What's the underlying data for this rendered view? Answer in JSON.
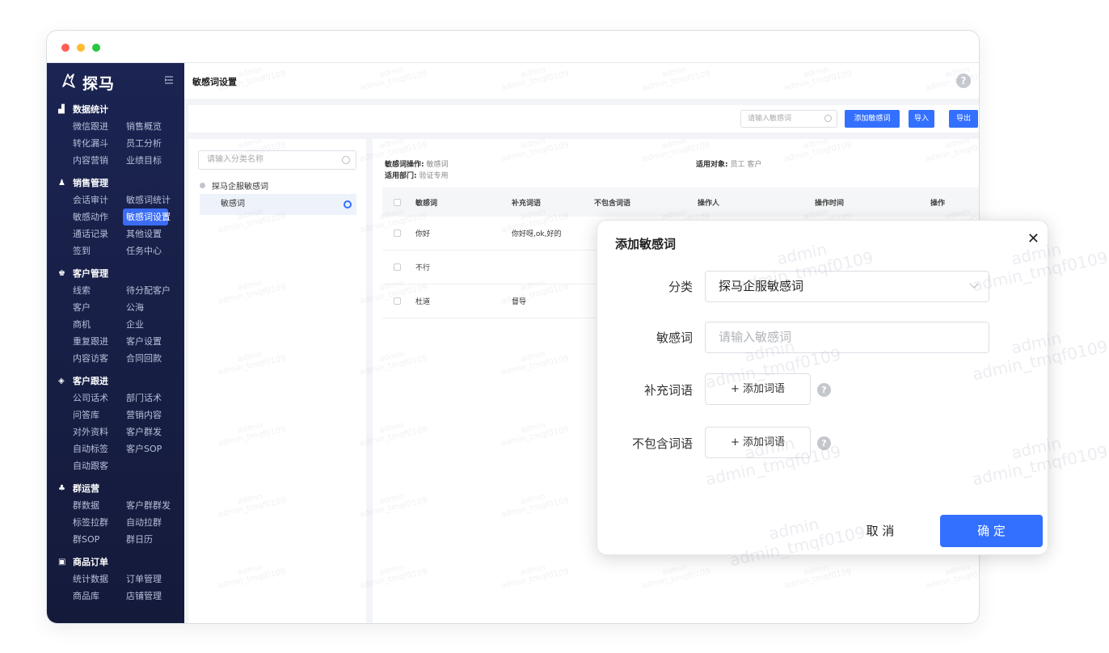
{
  "app": {
    "brand": "探马",
    "page_title": "敏感词设置"
  },
  "sidebar": {
    "sections": [
      {
        "title": "数据统计",
        "icon": "bar-chart-icon",
        "items": [
          "微信跟进",
          "销售概览",
          "转化漏斗",
          "员工分析",
          "内容营销",
          "业绩目标"
        ]
      },
      {
        "title": "销售管理",
        "icon": "user-icon",
        "items": [
          "会话审计",
          "敏感词统计",
          "敏感动作",
          "敏感词设置",
          "通话记录",
          "其他设置",
          "签到",
          "任务中心"
        ],
        "active": "敏感词设置"
      },
      {
        "title": "客户管理",
        "icon": "users-icon",
        "items": [
          "线索",
          "待分配客户",
          "客户",
          "公海",
          "商机",
          "企业",
          "重复跟进",
          "客户设置",
          "内容访客",
          "合同回款"
        ]
      },
      {
        "title": "客户跟进",
        "icon": "target-icon",
        "items": [
          "公司话术",
          "部门话术",
          "问答库",
          "营销内容",
          "对外资料",
          "客户群发",
          "自动标签",
          "客户SOP",
          "自动跟客"
        ]
      },
      {
        "title": "群运营",
        "icon": "group-icon",
        "items": [
          "群数据",
          "客户群群发",
          "标签拉群",
          "自动拉群",
          "群SOP",
          "群日历"
        ]
      },
      {
        "title": "商品订单",
        "icon": "box-icon",
        "items": [
          "统计数据",
          "订单管理",
          "商品库",
          "店铺管理"
        ]
      }
    ]
  },
  "toolbar": {
    "search_placeholder": "请输入敏感词",
    "add_label": "添加敏感词",
    "import_label": "导入",
    "export_label": "导出"
  },
  "category": {
    "search_placeholder": "请输入分类名称",
    "root": "探马企服敏感词",
    "child": "敏感词"
  },
  "meta": {
    "action_label": "敏感词操作:",
    "action_value": "敏感词",
    "dept_label": "适用部门:",
    "dept_value": "验证专用",
    "target_label": "适用对象:",
    "target_value": "员工 客户"
  },
  "table": {
    "columns": [
      "敏感词",
      "补充词语",
      "不包含词语",
      "操作人",
      "操作时间",
      "操作"
    ],
    "rows": [
      {
        "word": "你好",
        "extra": "你好呀,ok,好的"
      },
      {
        "word": "不行",
        "extra": ""
      },
      {
        "word": "杜道",
        "extra": "督导"
      }
    ]
  },
  "dialog": {
    "title": "添加敏感词",
    "category_label": "分类",
    "category_value": "探马企服敏感词",
    "word_label": "敏感词",
    "word_placeholder": "请输入敏感词",
    "extra_label": "补充词语",
    "extra_button": "+ 添加词语",
    "exclude_label": "不包含词语",
    "exclude_button": "+ 添加词语",
    "cancel": "取 消",
    "confirm": "确 定",
    "help": "?"
  },
  "watermark": {
    "line1": "admin",
    "line2": "admin_tmqf0109"
  }
}
